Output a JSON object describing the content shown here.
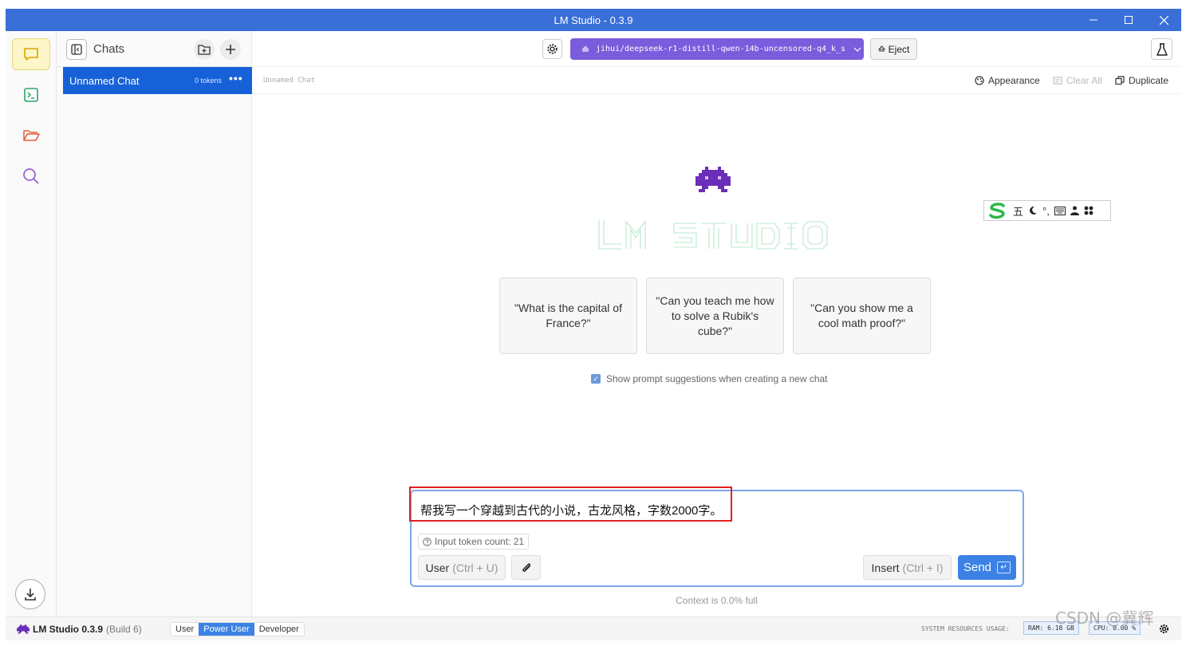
{
  "window": {
    "title": "LM Studio - 0.3.9"
  },
  "rail": {
    "items": [
      "chat-icon",
      "terminal-icon",
      "folder-icon",
      "search-icon"
    ],
    "download": "download-icon"
  },
  "chatlist": {
    "label": "Chats",
    "items": [
      {
        "name": "Unnamed Chat",
        "tokens": "0 tokens",
        "more": "•••"
      }
    ]
  },
  "topbar": {
    "model": "jihui/deepseek-r1-distill-qwen-14b-uncensored-q4_k_s",
    "eject": "Eject"
  },
  "subbar": {
    "crumb": "Unnamed Chat",
    "appearance": "Appearance",
    "clear_all": "Clear All",
    "duplicate": "Duplicate"
  },
  "suggestions": [
    "\"What is the capital of France?\"",
    "\"Can you teach me how to solve a Rubik's cube?\"",
    "\"Can you show me a cool math proof?\""
  ],
  "show_suggestions": {
    "label": "Show prompt suggestions when creating a new chat",
    "checked": true
  },
  "ime": {
    "labels": [
      "五",
      "°,"
    ]
  },
  "composer": {
    "text": "帮我写一个穿越到古代的小说，古龙风格，字数2000字。",
    "token_count": "Input token count: 21",
    "role": "User",
    "role_hint": "(Ctrl + U)",
    "insert": "Insert",
    "insert_hint": "(Ctrl + I)",
    "send": "Send",
    "send_key": "↵"
  },
  "context": "Context is 0.0% full",
  "status": {
    "app": "LM Studio 0.3.9",
    "build": "(Build 6)",
    "modes": [
      "User",
      "Power User",
      "Developer"
    ],
    "active_mode": "Power User",
    "resources_label": "SYSTEM RESOURCES USAGE:",
    "ram": "RAM: 6.18 GB",
    "cpu": "CPU: 0.00 %"
  },
  "watermark": "CSDN @冀辉",
  "colors": {
    "titlebar": "#3b6fd8",
    "accent": "#3b82e4",
    "model_pill": "#7b5cdc",
    "selected_chat": "#1761d8"
  }
}
